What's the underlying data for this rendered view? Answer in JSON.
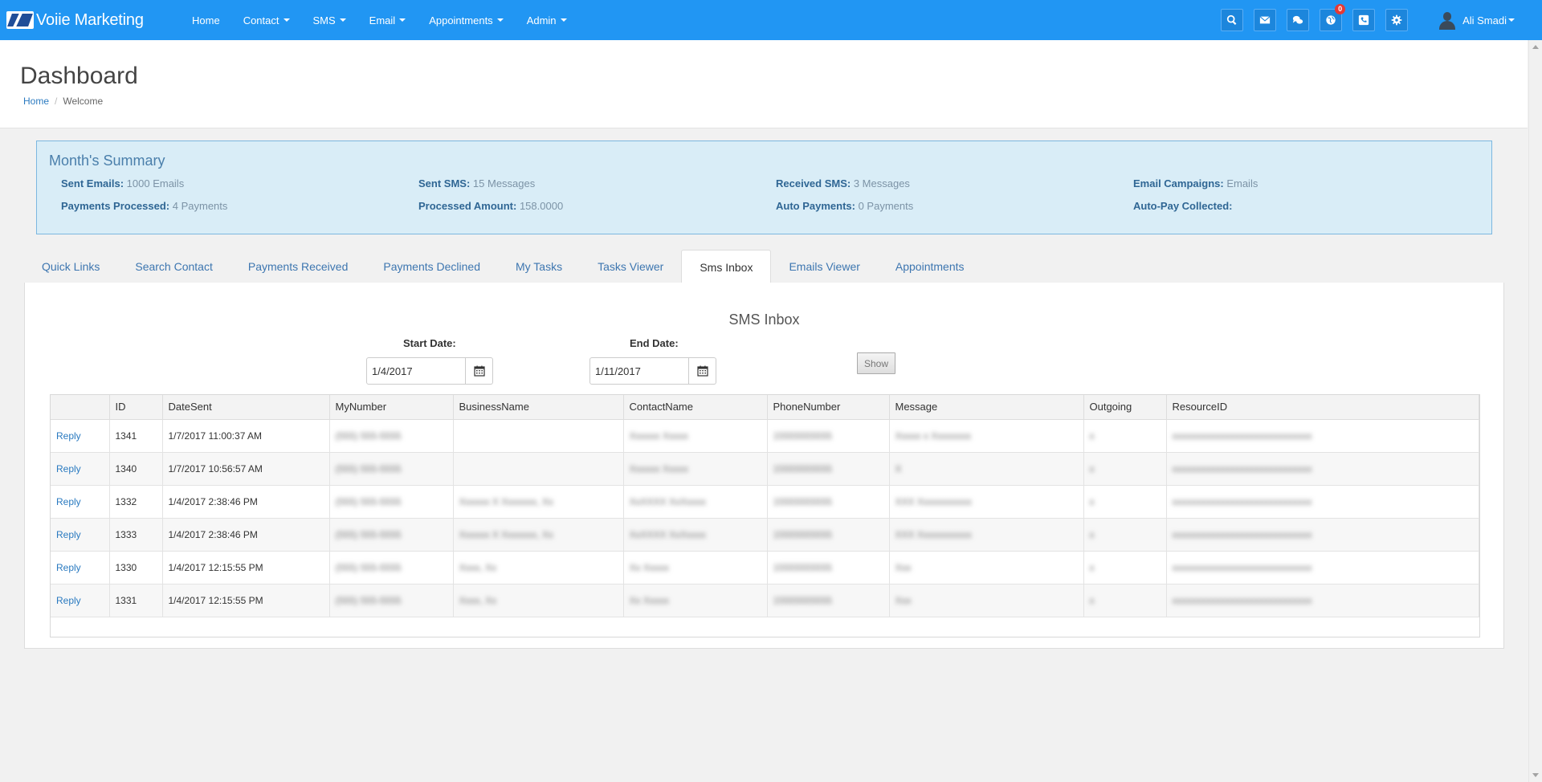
{
  "app": {
    "brand": "Voiie Marketing"
  },
  "nav": {
    "items": [
      "Home",
      "Contact",
      "SMS",
      "Email",
      "Appointments",
      "Admin"
    ],
    "notification_count": "0",
    "user_name": "Ali Smadi"
  },
  "header": {
    "title": "Dashboard",
    "breadcrumb": {
      "home": "Home",
      "current": "Welcome"
    }
  },
  "summary": {
    "title": "Month's Summary",
    "rows": [
      [
        {
          "label": "Sent Emails:",
          "value": "1000 Emails"
        },
        {
          "label": "Sent SMS:",
          "value": "15 Messages"
        },
        {
          "label": "Received SMS:",
          "value": "3 Messages"
        },
        {
          "label": "Email Campaigns:",
          "value": "Emails"
        }
      ],
      [
        {
          "label": "Payments Processed:",
          "value": "4 Payments"
        },
        {
          "label": "Processed Amount:",
          "value": "158.0000"
        },
        {
          "label": "Auto Payments:",
          "value": "0 Payments"
        },
        {
          "label": "Auto-Pay Collected:",
          "value": ""
        }
      ]
    ]
  },
  "tabs": [
    "Quick Links",
    "Search Contact",
    "Payments Received",
    "Payments Declined",
    "My Tasks",
    "Tasks Viewer",
    "Sms Inbox",
    "Emails Viewer",
    "Appointments"
  ],
  "active_tab": "Sms Inbox",
  "inbox": {
    "title": "SMS Inbox",
    "start_label": "Start Date:",
    "start_value": "1/4/2017",
    "end_label": "End Date:",
    "end_value": "1/11/2017",
    "show_label": "Show",
    "columns": [
      "",
      "ID",
      "DateSent",
      "MyNumber",
      "BusinessName",
      "ContactName",
      "PhoneNumber",
      "Message",
      "Outgoing",
      "ResourceID"
    ],
    "rows": [
      {
        "action": "Reply",
        "id": "1341",
        "date_sent": "1/7/2017 11:00:37 AM"
      },
      {
        "action": "Reply",
        "id": "1340",
        "date_sent": "1/7/2017 10:56:57 AM"
      },
      {
        "action": "Reply",
        "id": "1332",
        "date_sent": "1/4/2017 2:38:46 PM"
      },
      {
        "action": "Reply",
        "id": "1333",
        "date_sent": "1/4/2017 2:38:46 PM"
      },
      {
        "action": "Reply",
        "id": "1330",
        "date_sent": "1/4/2017 12:15:55 PM"
      },
      {
        "action": "Reply",
        "id": "1331",
        "date_sent": "1/4/2017 12:15:55 PM"
      }
    ]
  }
}
